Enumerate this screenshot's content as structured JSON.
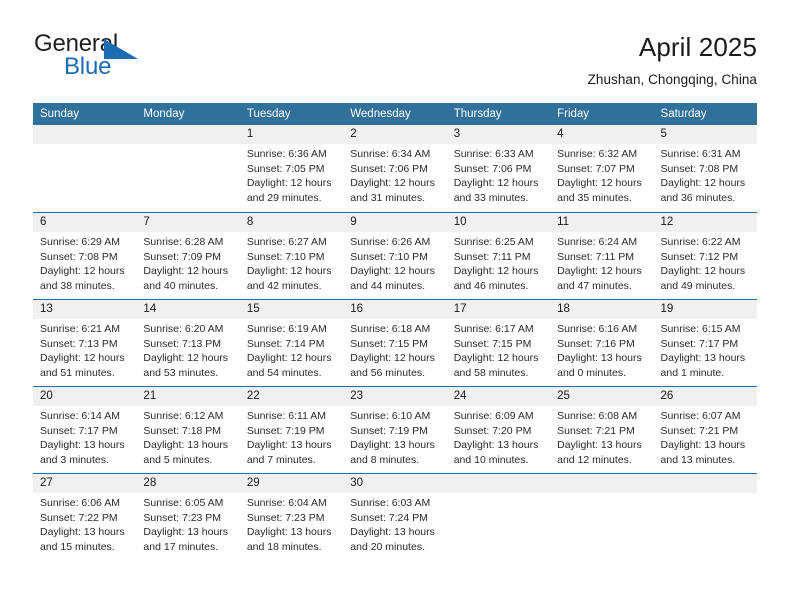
{
  "brand": {
    "name_part1": "General",
    "name_part2": "Blue",
    "accent_color": "#1b6cb3",
    "flag_icon": "triangle-flag-icon"
  },
  "header": {
    "title": "April 2025",
    "subtitle": "Zhushan, Chongqing, China"
  },
  "calendar": {
    "header_bg": "#30719c",
    "daynum_band_bg": "#f0f0f0",
    "separator_color": "#1b6cb3",
    "weekday_headers": [
      "Sunday",
      "Monday",
      "Tuesday",
      "Wednesday",
      "Thursday",
      "Friday",
      "Saturday"
    ],
    "weeks": [
      [
        {
          "day": "",
          "info": ""
        },
        {
          "day": "",
          "info": ""
        },
        {
          "day": "1",
          "info": "Sunrise: 6:36 AM\nSunset: 7:05 PM\nDaylight: 12 hours\nand 29 minutes."
        },
        {
          "day": "2",
          "info": "Sunrise: 6:34 AM\nSunset: 7:06 PM\nDaylight: 12 hours\nand 31 minutes."
        },
        {
          "day": "3",
          "info": "Sunrise: 6:33 AM\nSunset: 7:06 PM\nDaylight: 12 hours\nand 33 minutes."
        },
        {
          "day": "4",
          "info": "Sunrise: 6:32 AM\nSunset: 7:07 PM\nDaylight: 12 hours\nand 35 minutes."
        },
        {
          "day": "5",
          "info": "Sunrise: 6:31 AM\nSunset: 7:08 PM\nDaylight: 12 hours\nand 36 minutes."
        }
      ],
      [
        {
          "day": "6",
          "info": "Sunrise: 6:29 AM\nSunset: 7:08 PM\nDaylight: 12 hours\nand 38 minutes."
        },
        {
          "day": "7",
          "info": "Sunrise: 6:28 AM\nSunset: 7:09 PM\nDaylight: 12 hours\nand 40 minutes."
        },
        {
          "day": "8",
          "info": "Sunrise: 6:27 AM\nSunset: 7:10 PM\nDaylight: 12 hours\nand 42 minutes."
        },
        {
          "day": "9",
          "info": "Sunrise: 6:26 AM\nSunset: 7:10 PM\nDaylight: 12 hours\nand 44 minutes."
        },
        {
          "day": "10",
          "info": "Sunrise: 6:25 AM\nSunset: 7:11 PM\nDaylight: 12 hours\nand 46 minutes."
        },
        {
          "day": "11",
          "info": "Sunrise: 6:24 AM\nSunset: 7:11 PM\nDaylight: 12 hours\nand 47 minutes."
        },
        {
          "day": "12",
          "info": "Sunrise: 6:22 AM\nSunset: 7:12 PM\nDaylight: 12 hours\nand 49 minutes."
        }
      ],
      [
        {
          "day": "13",
          "info": "Sunrise: 6:21 AM\nSunset: 7:13 PM\nDaylight: 12 hours\nand 51 minutes."
        },
        {
          "day": "14",
          "info": "Sunrise: 6:20 AM\nSunset: 7:13 PM\nDaylight: 12 hours\nand 53 minutes."
        },
        {
          "day": "15",
          "info": "Sunrise: 6:19 AM\nSunset: 7:14 PM\nDaylight: 12 hours\nand 54 minutes."
        },
        {
          "day": "16",
          "info": "Sunrise: 6:18 AM\nSunset: 7:15 PM\nDaylight: 12 hours\nand 56 minutes."
        },
        {
          "day": "17",
          "info": "Sunrise: 6:17 AM\nSunset: 7:15 PM\nDaylight: 12 hours\nand 58 minutes."
        },
        {
          "day": "18",
          "info": "Sunrise: 6:16 AM\nSunset: 7:16 PM\nDaylight: 13 hours\nand 0 minutes."
        },
        {
          "day": "19",
          "info": "Sunrise: 6:15 AM\nSunset: 7:17 PM\nDaylight: 13 hours\nand 1 minute."
        }
      ],
      [
        {
          "day": "20",
          "info": "Sunrise: 6:14 AM\nSunset: 7:17 PM\nDaylight: 13 hours\nand 3 minutes."
        },
        {
          "day": "21",
          "info": "Sunrise: 6:12 AM\nSunset: 7:18 PM\nDaylight: 13 hours\nand 5 minutes."
        },
        {
          "day": "22",
          "info": "Sunrise: 6:11 AM\nSunset: 7:19 PM\nDaylight: 13 hours\nand 7 minutes."
        },
        {
          "day": "23",
          "info": "Sunrise: 6:10 AM\nSunset: 7:19 PM\nDaylight: 13 hours\nand 8 minutes."
        },
        {
          "day": "24",
          "info": "Sunrise: 6:09 AM\nSunset: 7:20 PM\nDaylight: 13 hours\nand 10 minutes."
        },
        {
          "day": "25",
          "info": "Sunrise: 6:08 AM\nSunset: 7:21 PM\nDaylight: 13 hours\nand 12 minutes."
        },
        {
          "day": "26",
          "info": "Sunrise: 6:07 AM\nSunset: 7:21 PM\nDaylight: 13 hours\nand 13 minutes."
        }
      ],
      [
        {
          "day": "27",
          "info": "Sunrise: 6:06 AM\nSunset: 7:22 PM\nDaylight: 13 hours\nand 15 minutes."
        },
        {
          "day": "28",
          "info": "Sunrise: 6:05 AM\nSunset: 7:23 PM\nDaylight: 13 hours\nand 17 minutes."
        },
        {
          "day": "29",
          "info": "Sunrise: 6:04 AM\nSunset: 7:23 PM\nDaylight: 13 hours\nand 18 minutes."
        },
        {
          "day": "30",
          "info": "Sunrise: 6:03 AM\nSunset: 7:24 PM\nDaylight: 13 hours\nand 20 minutes."
        },
        {
          "day": "",
          "info": ""
        },
        {
          "day": "",
          "info": ""
        },
        {
          "day": "",
          "info": ""
        }
      ]
    ]
  }
}
